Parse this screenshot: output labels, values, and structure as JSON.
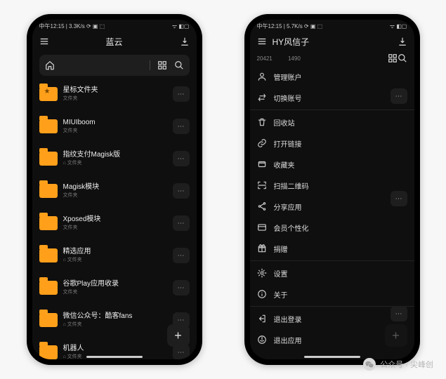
{
  "phone1": {
    "status": {
      "left": "中午12:15 | 3.3K/s ⟳ ▣ ⬚",
      "right": "ᯤ ◧▢"
    },
    "title": "蓝云",
    "folders": [
      {
        "name": "星标文件夹",
        "meta": "文件夹",
        "star": true
      },
      {
        "name": "MIUIboom",
        "meta": "文件夹"
      },
      {
        "name": "指纹支付Magisk版",
        "meta": "⌂ 文件夹"
      },
      {
        "name": "Magisk模块",
        "meta": "文件夹"
      },
      {
        "name": "Xposed模块",
        "meta": "文件夹"
      },
      {
        "name": "精选应用",
        "meta": "⌂ 文件夹"
      },
      {
        "name": "谷歌Play应用收录",
        "meta": "文件夹"
      },
      {
        "name": "微信公众号：酷客fans",
        "meta": "⌂ 文件夹"
      },
      {
        "name": "机器人",
        "meta": "⌂ 文件夹"
      }
    ]
  },
  "phone2": {
    "status": {
      "left": "中午12:15 | 5.7K/s ⟳ ▣ ⬚",
      "right": "ᯤ ◧▢"
    },
    "title": "HY风信子",
    "numbers": "20421          1490",
    "menu": [
      {
        "icon": "account",
        "label": "管理账户"
      },
      {
        "icon": "swap",
        "label": "切换账号"
      },
      {
        "sep": true
      },
      {
        "icon": "trash",
        "label": "回收站"
      },
      {
        "icon": "link",
        "label": "打开链接"
      },
      {
        "icon": "bookmark",
        "label": "收藏夹"
      },
      {
        "icon": "scan",
        "label": "扫描二维码"
      },
      {
        "icon": "share",
        "label": "分享应用"
      },
      {
        "icon": "vip",
        "label": "会员个性化"
      },
      {
        "icon": "gift",
        "label": "捐赠"
      },
      {
        "sep": true
      },
      {
        "icon": "gear",
        "label": "设置"
      },
      {
        "icon": "info",
        "label": "关于"
      },
      {
        "sep": true
      },
      {
        "icon": "logout",
        "label": "退出登录"
      },
      {
        "icon": "exit",
        "label": "退出应用"
      }
    ]
  },
  "watermark": {
    "text": "公众号 · 尖峰创"
  }
}
